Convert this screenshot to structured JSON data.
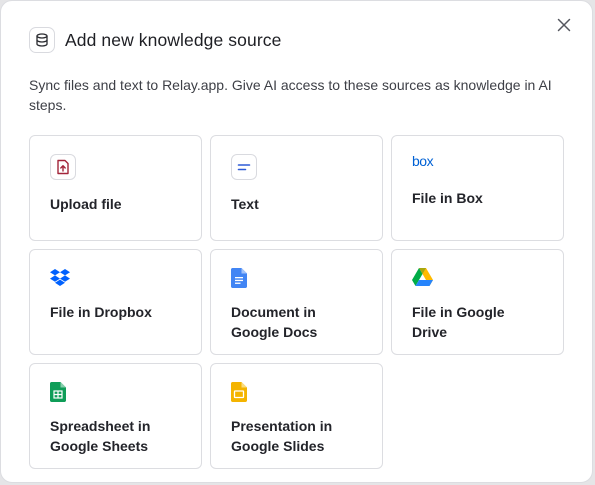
{
  "dialog": {
    "title": "Add new knowledge source",
    "header_icon": "database-icon",
    "close_icon": "close-icon",
    "description": "Sync files and text to Relay.app. Give AI access to these sources as knowledge in AI steps."
  },
  "sources": [
    {
      "label": "Upload file",
      "icon": "upload-file-icon"
    },
    {
      "label": "Text",
      "icon": "text-icon"
    },
    {
      "label": "File in Box",
      "icon": "box-logo-icon",
      "icon_text": "box"
    },
    {
      "label": "File in Dropbox",
      "icon": "dropbox-logo-icon"
    },
    {
      "label": "Document in Google Docs",
      "icon": "google-docs-icon"
    },
    {
      "label": "File in Google Drive",
      "icon": "google-drive-icon"
    },
    {
      "label": "Spreadsheet in Google Sheets",
      "icon": "google-sheets-icon"
    },
    {
      "label": "Presentation in Google Slides",
      "icon": "google-slides-icon"
    }
  ],
  "colors": {
    "upload_red": "#a3253a",
    "text_blue": "#2f5bd6",
    "box_blue": "#0061d5",
    "dropbox_blue": "#0061fe",
    "docs_blue": "#4285f4",
    "sheets_green": "#0f9d58",
    "slides_yellow": "#f4b400"
  }
}
